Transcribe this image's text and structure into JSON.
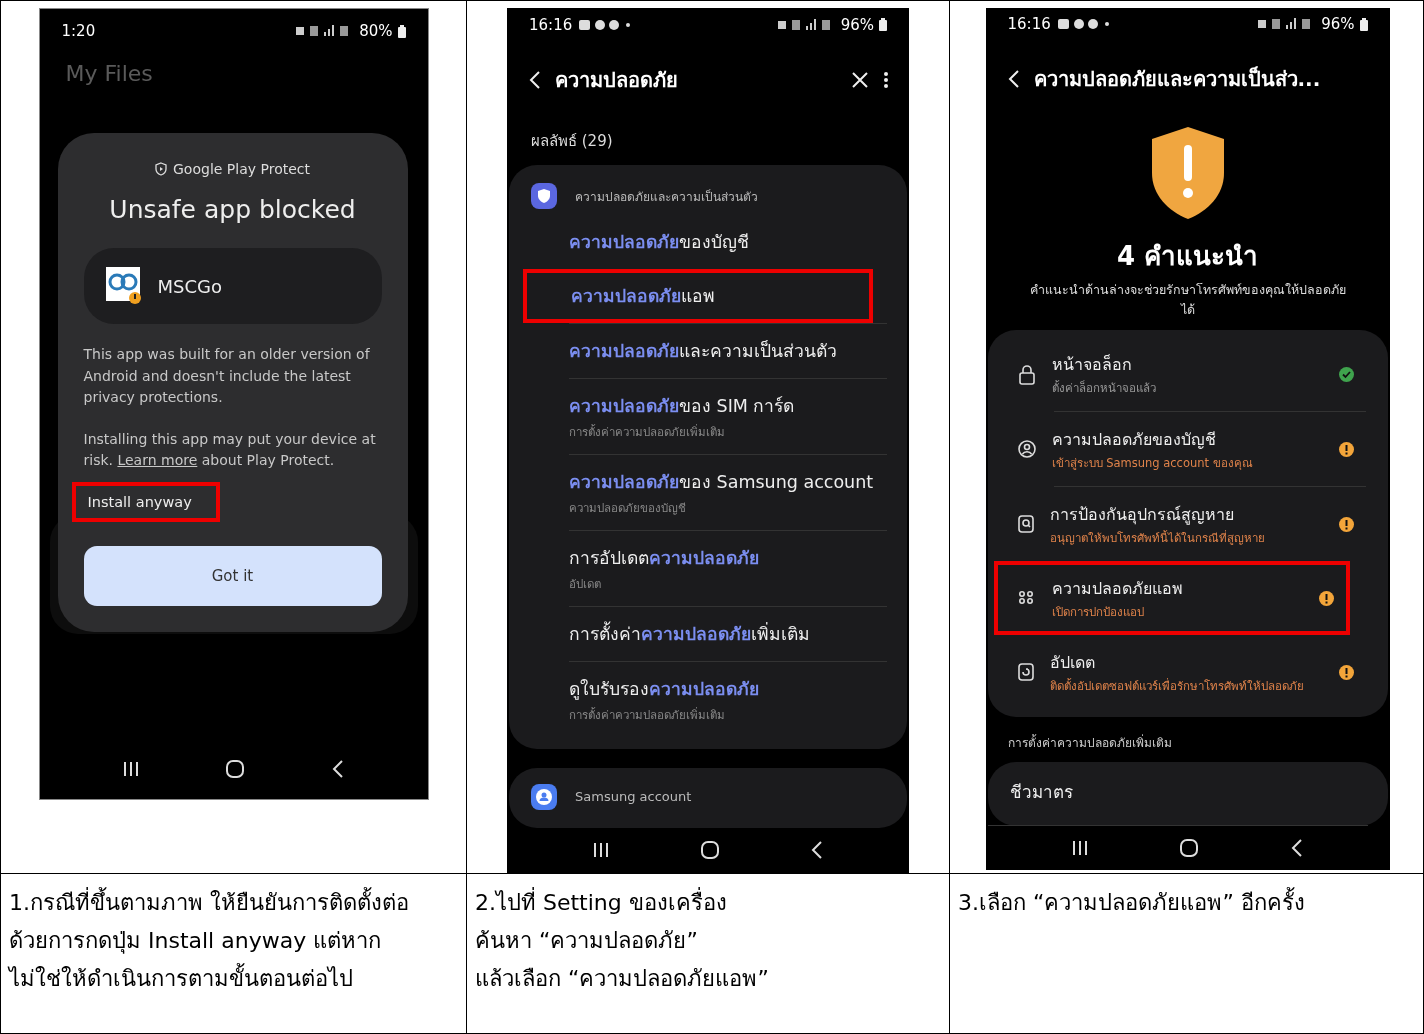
{
  "steps": [
    {
      "kind": "play_protect",
      "phone": {
        "status_bar": {
          "time": "1:20",
          "battery": "80%"
        },
        "background": {
          "title": "My Files"
        },
        "dialog": {
          "brand": "Google Play Protect",
          "title": "Unsafe app blocked",
          "app_name": "MSCGo",
          "paragraphs": [
            "This app was built for an older version of Android and doesn't include the latest privacy protections."
          ],
          "risk_text": "Installing this app may put your device at risk.",
          "link": "Learn more",
          "risk_suffix": "about Play Protect.",
          "install": {
            "label": "Install anyway",
            "highlighted": true
          },
          "primary_button": "Got it"
        }
      },
      "caption": "1.กรณีที่ขึ้นตามภาพ ให้ยืนยันการติดตั้งต่อ\nด้วยการกดปุ่ม Install anyway แต่หาก\nไม่ใช่ให้ดำเนินการตามขั้นตอนต่อไป"
    },
    {
      "kind": "search",
      "phone": {
        "status_bar": {
          "time": "16:16",
          "battery": "96%"
        },
        "title": "ความปลอดภัย",
        "result_count": "ผลลัพธ์ (29)",
        "group": "ความปลอดภัยและความเป็นส่วนตัว",
        "results": [
          {
            "title": "**ความปลอดภัย**ของบัญชี",
            "highlighted": false
          },
          {
            "title": "**ความปลอดภัย**แอพ",
            "highlighted": true
          },
          {
            "title": "**ความปลอดภัย**และความเป็นส่วนตัว",
            "highlighted": false
          },
          {
            "title": "**ความปลอดภัย**ของ SIM การ์ด",
            "subtitle": "การตั้งค่าความปลอดภัยเพิ่มเติม",
            "highlighted": false
          },
          {
            "title": "**ความปลอดภัย**ของ Samsung account",
            "subtitle": "ความปลอดภัยของบัญชี",
            "highlighted": false
          },
          {
            "title": "การอัปเดต**ความปลอดภัย**",
            "subtitle": "อัปเดต",
            "highlighted": false
          },
          {
            "title": "การตั้งค่า**ความปลอดภัย**เพิ่มเติม",
            "highlighted": false
          },
          {
            "title": "ดูใบรับรอง**ความปลอดภัย**",
            "subtitle": "การตั้งค่าความปลอดภัยเพิ่มเติม",
            "highlighted": false
          }
        ],
        "second_group": "Samsung account"
      },
      "caption": "2.ไปที่ Setting ของเครื่อง\nค้นหา “ความปลอดภัย”\nแล้วเลือก “ความปลอดภัยแอพ”"
    },
    {
      "kind": "security",
      "phone": {
        "status_bar": {
          "time": "16:16",
          "battery": "96%"
        },
        "title": "ความปลอดภัยและความเป็นส่ว...",
        "count": "4 คำแนะนำ",
        "description": "คำแนะนำด้านล่างจะช่วยรักษาโทรศัพท์ของคุณให้ปลอดภัยได้",
        "rows": [
          {
            "kind": "lock",
            "title": "หน้าจอล็อก",
            "subtitle": "ตั้งค่าล็อกหน้าจอแล้ว",
            "warning": false,
            "highlighted": false
          },
          {
            "kind": "account",
            "title": "ความปลอดภัยของบัญชี",
            "subtitle": "เข้าสู่ระบบ Samsung account ของคุณ",
            "warning": true,
            "highlighted": false
          },
          {
            "kind": "find",
            "title": "การป้องกันอุปกรณ์สูญหาย",
            "subtitle": "อนุญาตให้พบโทรศัพท์นี้ได้ในกรณีที่สูญหาย",
            "warning": true,
            "highlighted": false
          },
          {
            "kind": "apps",
            "title": "ความปลอดภัยแอพ",
            "subtitle": "เปิดการปกป้องแอป",
            "warning": true,
            "highlighted": true
          },
          {
            "kind": "update",
            "title": "อัปเดต",
            "subtitle": "ติดตั้งอัปเดตซอฟต์แวร์เพื่อรักษาโทรศัพท์ให้ปลอดภัย",
            "warning": true,
            "highlighted": false
          }
        ],
        "section": "การตั้งค่าความปลอดภัยเพิ่มเติม",
        "more": [
          "ชีวมาตร"
        ]
      },
      "caption": "3.เลือก “ความปลอดภัยแอพ” อีกครั้ง"
    }
  ]
}
